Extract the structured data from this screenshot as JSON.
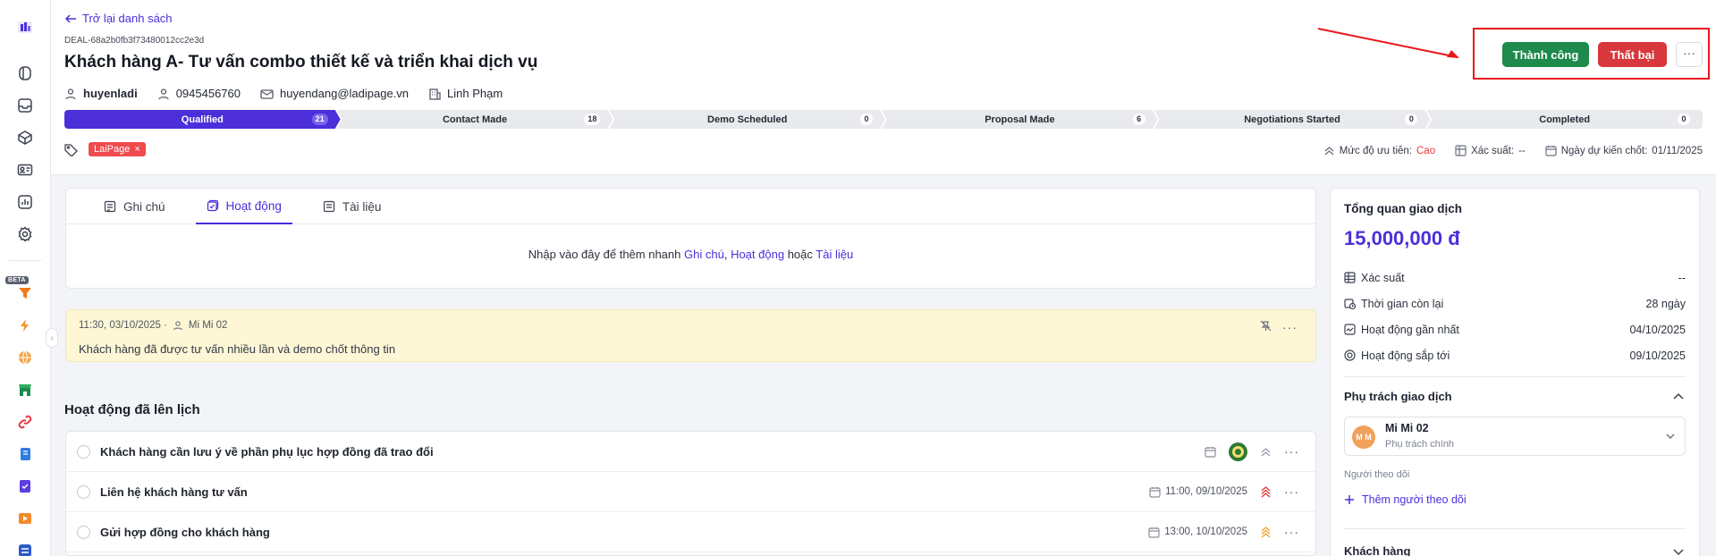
{
  "nav": {
    "back_label": "Trở lại danh sách",
    "beta_label": "BETA",
    "icons": [
      "logo-icon",
      "contacts-icon",
      "inbox-icon",
      "products-icon",
      "id-card-icon",
      "reports-icon",
      "settings-icon",
      "funnel-icon",
      "flash-icon",
      "globe-icon",
      "store-icon",
      "link-icon",
      "book-icon",
      "checklist-icon",
      "media-icon",
      "workflow-icon"
    ]
  },
  "deal": {
    "id": "DEAL-68a2b0fb3f73480012cc2e3d",
    "title": "Khách hàng A- Tư vấn combo thiết kế và triển khai dịch vụ",
    "owner_username": "huyenladi",
    "phone": "0945456760",
    "email": "huyendang@ladipage.vn",
    "company": "Linh Phạm"
  },
  "actions": {
    "success_label": "Thành công",
    "fail_label": "Thất bại",
    "more_label": "···"
  },
  "pipeline": [
    {
      "name": "Qualified",
      "count": "21",
      "active": true
    },
    {
      "name": "Contact Made",
      "count": "18",
      "active": false
    },
    {
      "name": "Demo Scheduled",
      "count": "0",
      "active": false
    },
    {
      "name": "Proposal Made",
      "count": "6",
      "active": false
    },
    {
      "name": "Negotiations Started",
      "count": "0",
      "active": false
    },
    {
      "name": "Completed",
      "count": "0",
      "active": false
    }
  ],
  "tags": [
    {
      "label": "LaiPage"
    }
  ],
  "summary_meta": {
    "priority_label": "Mức độ ưu tiên:",
    "priority_value": "Cao",
    "probability_label": "Xác suất:",
    "probability_value": "--",
    "close_label": "Ngày dự kiến chốt:",
    "close_value": "01/11/2025"
  },
  "tabs": [
    {
      "label": "Ghi chú",
      "active": false
    },
    {
      "label": "Hoạt động",
      "active": true
    },
    {
      "label": "Tài liệu",
      "active": false
    }
  ],
  "quick_add": {
    "prefix": "Nhập vào đây để thêm nhanh",
    "link1": "Ghi chú",
    "sep": ",",
    "link2": "Hoạt động",
    "mid": "hoặc",
    "link3": "Tài liệu"
  },
  "note": {
    "time": "11:30, 03/10/2025 ·",
    "author": "Mi Mi 02",
    "text": "Khách hàng đã được tư vấn nhiều lần và demo chốt thông tin"
  },
  "scheduled": {
    "title": "Hoạt động đã lên lịch",
    "items": [
      {
        "title": "Khách hàng cần lưu ý về phần phụ lục hợp đồng đã trao đổi",
        "due": "",
        "priority_color": "#9aa0ad"
      },
      {
        "title": "Liên hệ khách hàng tư vấn",
        "due": "11:00, 09/10/2025",
        "priority_color": "#e4393d"
      },
      {
        "title": "Gửi hợp đồng cho khách hàng",
        "due": "13:00, 10/10/2025",
        "priority_color": "#f2a53a"
      }
    ]
  },
  "overview": {
    "title": "Tổng quan giao dịch",
    "amount": "15,000,000 đ",
    "rows": [
      {
        "label": "Xác suất",
        "value": "--",
        "icon": "probability-icon"
      },
      {
        "label": "Thời gian còn lại",
        "value": "28 ngày",
        "icon": "calendar-clock-icon"
      },
      {
        "label": "Hoạt động gần nhất",
        "value": "04/10/2025",
        "icon": "activity-icon"
      },
      {
        "label": "Hoạt động sắp tới",
        "value": "09/10/2025",
        "icon": "upcoming-icon"
      }
    ],
    "owner_section": "Phụ trách giao dịch",
    "owner": {
      "initials": "M M",
      "name": "Mi Mi 02",
      "role": "Phụ trách chính"
    },
    "followers_label": "Người theo dõi",
    "add_follower": "Thêm người theo dõi",
    "customer_section": "Khách hàng"
  },
  "colors": {
    "accent": "#4c2fd9",
    "success": "#1e8a4c",
    "danger": "#d8373b",
    "highlight_box": "#e8161b",
    "note_bg": "#fdf7d5"
  }
}
